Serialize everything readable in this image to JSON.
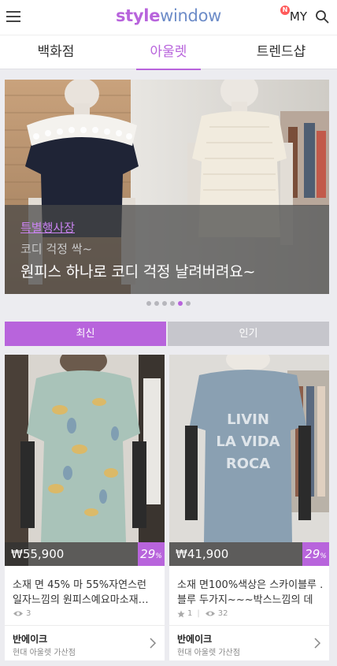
{
  "header": {
    "logo_part1": "style",
    "logo_part2": "window",
    "my_label": "MY",
    "my_badge": "N"
  },
  "nav_tabs": [
    {
      "label": "백화점",
      "active": false
    },
    {
      "label": "아울렛",
      "active": true
    },
    {
      "label": "트렌드샵",
      "active": false
    }
  ],
  "banner": {
    "tag": "특별행사장",
    "subtitle": "코디 걱정 싹~",
    "title": "원피스 하나로 코디 걱정 날려버려요~",
    "dots_total": 6,
    "dot_active_index": 4
  },
  "sort_tabs": {
    "latest": "최신",
    "popular": "인기"
  },
  "products": [
    {
      "price": "₩55,900",
      "discount": "29",
      "discount_unit": "%",
      "description": "소재 면 45%          마 55%자연스런 일자느낌의  원피스예요마소재…",
      "views": "3",
      "likes": "",
      "shop": "반에이크",
      "branch": "현대 아울렛 가산점"
    },
    {
      "price": "₩41,900",
      "discount": "29",
      "discount_unit": "%",
      "description": "소재 면100%색상은 스카이블루 .블루 두가지~~~박스느낌의 데님…",
      "views": "32",
      "likes": "1",
      "shop": "반에이크",
      "branch": "현대 아울렛 가산점"
    }
  ],
  "colors": {
    "accent": "#b864dc",
    "logo_secondary": "#6d8cc8"
  }
}
